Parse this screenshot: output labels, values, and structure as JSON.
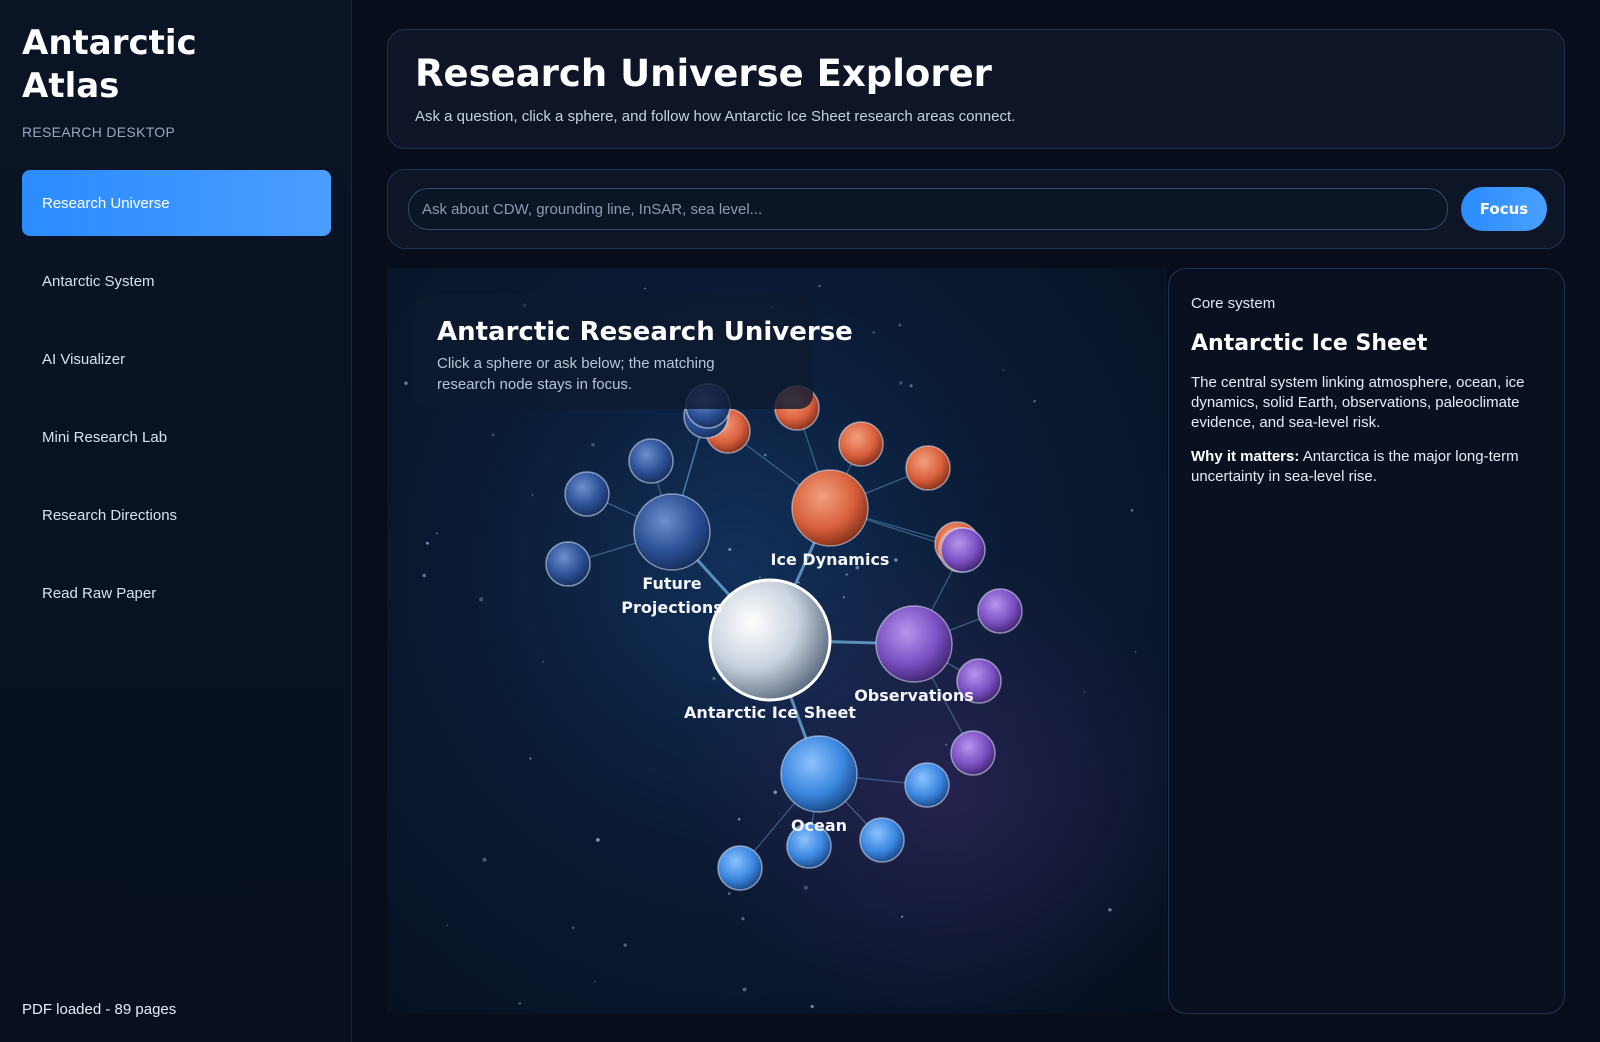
{
  "sidebar": {
    "brand": "Antarctic Atlas",
    "subtitle": "RESEARCH DESKTOP",
    "items": [
      {
        "label": "Research Universe",
        "active": true
      },
      {
        "label": "Antarctic System",
        "active": false
      },
      {
        "label": "AI Visualizer",
        "active": false
      },
      {
        "label": "Mini Research Lab",
        "active": false
      },
      {
        "label": "Research Directions",
        "active": false
      },
      {
        "label": "Read Raw Paper",
        "active": false
      }
    ],
    "footer": "PDF loaded - 89 pages"
  },
  "header": {
    "title": "Research Universe Explorer",
    "subtitle": "Ask a question, click a sphere, and follow how Antarctic Ice Sheet research areas connect."
  },
  "search": {
    "placeholder": "Ask about CDW, grounding line, InSAR, sea level...",
    "value": "",
    "button_label": "Focus"
  },
  "universe": {
    "title": "Antarctic Research Universe",
    "hint": "Click a sphere or ask below; the matching research node stays in focus.",
    "colors": {
      "core": "#dfe6ee",
      "ice_dynamics": "#e2764f",
      "future_projections": "#2f5fa8",
      "observations": "#8a5fd1",
      "ocean": "#3f8fe6",
      "link": "#6aa8d6"
    },
    "main_nodes": [
      {
        "id": "core",
        "label": "Antarctic Ice Sheet",
        "color": "core"
      },
      {
        "id": "ice",
        "label": "Ice Dynamics",
        "color": "ice_dynamics"
      },
      {
        "id": "future",
        "label": "Future Projections",
        "color": "future_projections"
      },
      {
        "id": "obs",
        "label": "Observations",
        "color": "observations"
      },
      {
        "id": "ocean",
        "label": "Ocean",
        "color": "ocean"
      }
    ]
  },
  "detail": {
    "kicker": "Core system",
    "title": "Antarctic Ice Sheet",
    "description": "The central system linking atmosphere, ocean, ice dynamics, solid Earth, observations, paleoclimate evidence, and sea-level risk.",
    "why_label": "Why it matters:",
    "why_text": " Antarctica is the major long-term uncertainty in sea-level rise."
  }
}
